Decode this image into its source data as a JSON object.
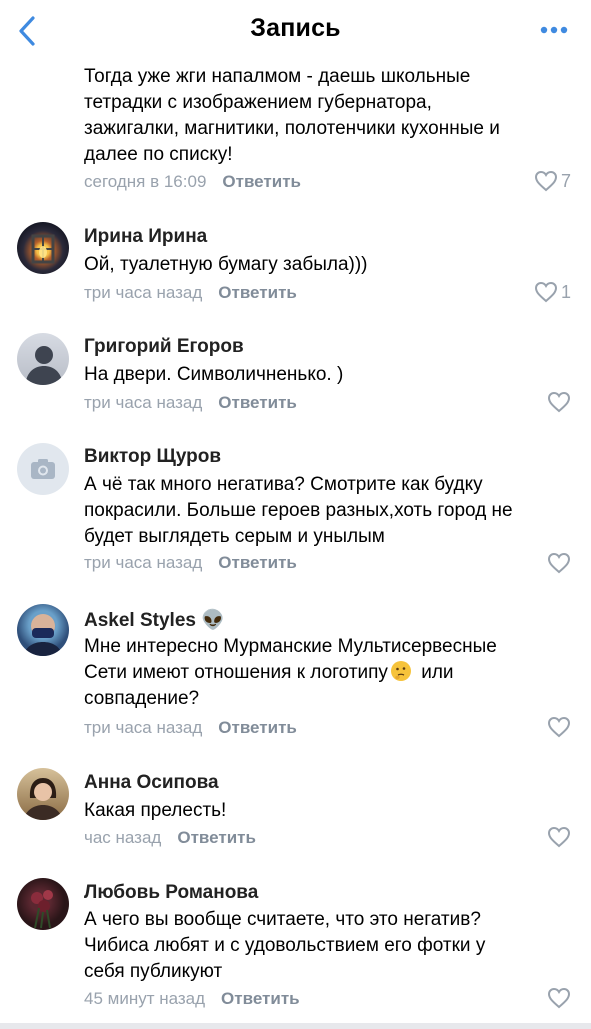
{
  "header": {
    "title": "Запись",
    "back_icon": "chevron-left-icon",
    "more_icon": "more-dots-icon",
    "accent": "#3f8ae0"
  },
  "comments": [
    {
      "name": "",
      "text": "Тогда уже жги напалмом - даешь школьные\nтетрадки с изображением губернатора,\nзажигалки, магнитики, полотенчики кухонные и\nдалее по списку!",
      "time": "сегодня в 16:09",
      "reply": "Ответить",
      "likes": "7"
    },
    {
      "name": "Ирина Ирина",
      "text": "Ой, туалетную бумагу забыла)))",
      "time": "три часа назад",
      "reply": "Ответить",
      "likes": "1"
    },
    {
      "name": "Григорий Егоров",
      "text": "На двери. Символичненько. )",
      "time": "три часа назад",
      "reply": "Ответить",
      "likes": ""
    },
    {
      "name": "Виктор Щуров",
      "text": "А чё так много негатива? Смотрите как будку\nпокрасили. Больше героев разных,хоть город не\nбудет выглядеть серым и унылым",
      "time": "три часа назад",
      "reply": "Ответить",
      "likes": ""
    },
    {
      "name": "Askel Styles 👽",
      "text_part1": "Мне интересно Мурманские Мультисервесные\nСети имеют отношения к логотипу",
      "text_part2": " или\nсовпадение?",
      "time": "три часа назад",
      "reply": "Ответить",
      "likes": ""
    },
    {
      "name": "Анна Осипова",
      "text": "Какая прелесть!",
      "time": "час назад",
      "reply": "Ответить",
      "likes": ""
    },
    {
      "name": "Любовь Романова",
      "text": "А чего вы вообще считаете, что это негатив?\nЧибиса любят и с удовольствием его фотки у\nсебя публикуют",
      "time": "45 минут назад",
      "reply": "Ответить",
      "likes": ""
    }
  ]
}
